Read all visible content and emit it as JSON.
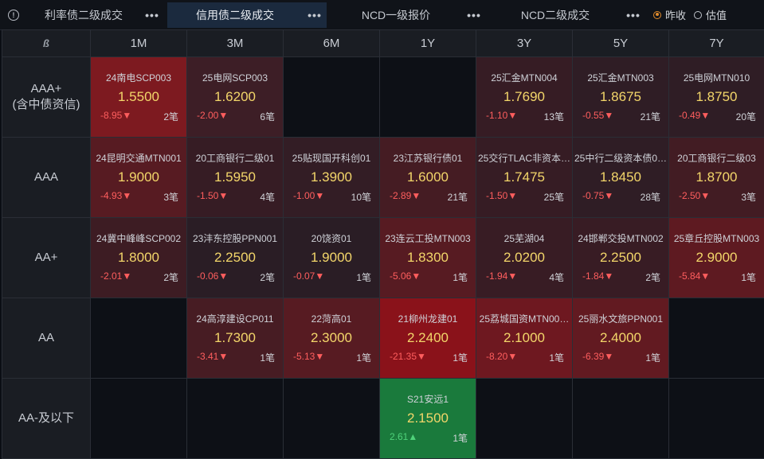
{
  "tabs": [
    {
      "label": "利率债二级成交",
      "active": false
    },
    {
      "label": "信用债二级成交",
      "active": true
    },
    {
      "label": "NCD一级报价",
      "active": false
    },
    {
      "label": "NCD二级成交",
      "active": false
    }
  ],
  "more_icon": "•••",
  "radios": [
    {
      "label": "昨收",
      "checked": true
    },
    {
      "label": "估值",
      "checked": false
    }
  ],
  "corner_glyph": "ß",
  "columns": [
    "1M",
    "3M",
    "6M",
    "1Y",
    "3Y",
    "5Y",
    "7Y"
  ],
  "colors": {
    "strong_red": "#8d1219",
    "mid_red": "#5c1a20",
    "weak_red": "#3a1c24",
    "green": "#1a7a3c"
  },
  "rows": [
    {
      "label": "AAA+\n(含中债资信)",
      "cells": [
        {
          "name": "24南电SCP003",
          "yield": "1.5500",
          "chg": "-8.95▼",
          "cnt": "2笔",
          "dir": "down",
          "bg": "#7d1a20"
        },
        {
          "name": "25电网SCP003",
          "yield": "1.6200",
          "chg": "-2.00▼",
          "cnt": "6笔",
          "dir": "down",
          "bg": "#3d1e26"
        },
        null,
        null,
        {
          "name": "25汇金MTN004",
          "yield": "1.7690",
          "chg": "-1.10▼",
          "cnt": "13笔",
          "dir": "down",
          "bg": "#361c24"
        },
        {
          "name": "25汇金MTN003",
          "yield": "1.8675",
          "chg": "-0.55▼",
          "cnt": "21笔",
          "dir": "down",
          "bg": "#2f1d25"
        },
        {
          "name": "25电网MTN010",
          "yield": "1.8750",
          "chg": "-0.49▼",
          "cnt": "20笔",
          "dir": "down",
          "bg": "#2f1d25"
        }
      ]
    },
    {
      "label": "AAA",
      "cells": [
        {
          "name": "24昆明交通MTN001",
          "yield": "1.9000",
          "chg": "-4.93▼",
          "cnt": "3笔",
          "dir": "down",
          "bg": "#571b22"
        },
        {
          "name": "20工商银行二级01",
          "yield": "1.5950",
          "chg": "-1.50▼",
          "cnt": "4笔",
          "dir": "down",
          "bg": "#361c24"
        },
        {
          "name": "25贴现国开科创01",
          "yield": "1.3900",
          "chg": "-1.00▼",
          "cnt": "10笔",
          "dir": "down",
          "bg": "#331d25"
        },
        {
          "name": "23江苏银行债01",
          "yield": "1.6000",
          "chg": "-2.89▼",
          "cnt": "21笔",
          "dir": "down",
          "bg": "#451c23"
        },
        {
          "name": "25交行TLAC非资本…",
          "yield": "1.7475",
          "chg": "-1.50▼",
          "cnt": "25笔",
          "dir": "down",
          "bg": "#361c24"
        },
        {
          "name": "25中行二级资本债0…",
          "yield": "1.8450",
          "chg": "-0.75▼",
          "cnt": "28笔",
          "dir": "down",
          "bg": "#2f1d25"
        },
        {
          "name": "20工商银行二级03",
          "yield": "1.8700",
          "chg": "-2.50▼",
          "cnt": "3笔",
          "dir": "down",
          "bg": "#421c23"
        }
      ]
    },
    {
      "label": "AA+",
      "cells": [
        {
          "name": "24冀中峰峰SCP002",
          "yield": "1.8000",
          "chg": "-2.01▼",
          "cnt": "2笔",
          "dir": "down",
          "bg": "#3d1c23"
        },
        {
          "name": "23沣东控股PPN001",
          "yield": "2.2500",
          "chg": "-0.06▼",
          "cnt": "2笔",
          "dir": "down",
          "bg": "#2a1d25"
        },
        {
          "name": "20饶资01",
          "yield": "1.9000",
          "chg": "-0.07▼",
          "cnt": "1笔",
          "dir": "down",
          "bg": "#2a1d25"
        },
        {
          "name": "23连云工投MTN003",
          "yield": "1.8300",
          "chg": "-5.06▼",
          "cnt": "1笔",
          "dir": "down",
          "bg": "#571b22"
        },
        {
          "name": "25芜湖04",
          "yield": "2.0200",
          "chg": "-1.94▼",
          "cnt": "4笔",
          "dir": "down",
          "bg": "#381c24"
        },
        {
          "name": "24邯郸交投MTN002",
          "yield": "2.2500",
          "chg": "-1.84▼",
          "cnt": "2笔",
          "dir": "down",
          "bg": "#381c24"
        },
        {
          "name": "25章丘控股MTN003",
          "yield": "2.9000",
          "chg": "-5.84▼",
          "cnt": "1笔",
          "dir": "down",
          "bg": "#5e1a21"
        }
      ]
    },
    {
      "label": "AA",
      "cells": [
        null,
        {
          "name": "24高淳建设CP011",
          "yield": "1.7300",
          "chg": "-3.41▼",
          "cnt": "1笔",
          "dir": "down",
          "bg": "#471c23"
        },
        {
          "name": "22菏高01",
          "yield": "2.3000",
          "chg": "-5.13▼",
          "cnt": "1笔",
          "dir": "down",
          "bg": "#571b22"
        },
        {
          "name": "21柳州龙建01",
          "yield": "2.2400",
          "chg": "-21.35▼",
          "cnt": "1笔",
          "dir": "down",
          "bg": "#8a121a"
        },
        {
          "name": "25荔城国资MTN00…",
          "yield": "2.1000",
          "chg": "-8.20▼",
          "cnt": "1笔",
          "dir": "down",
          "bg": "#6e1820"
        },
        {
          "name": "25丽水文旅PPN001",
          "yield": "2.4000",
          "chg": "-6.39▼",
          "cnt": "1笔",
          "dir": "down",
          "bg": "#621a21"
        },
        null
      ]
    },
    {
      "label": "AA-及以下",
      "cells": [
        null,
        null,
        null,
        {
          "name": "S21安远1",
          "yield": "2.1500",
          "chg": "2.61▲",
          "cnt": "1笔",
          "dir": "up",
          "bg": "#1a7a3c"
        },
        null,
        null,
        null
      ]
    }
  ]
}
